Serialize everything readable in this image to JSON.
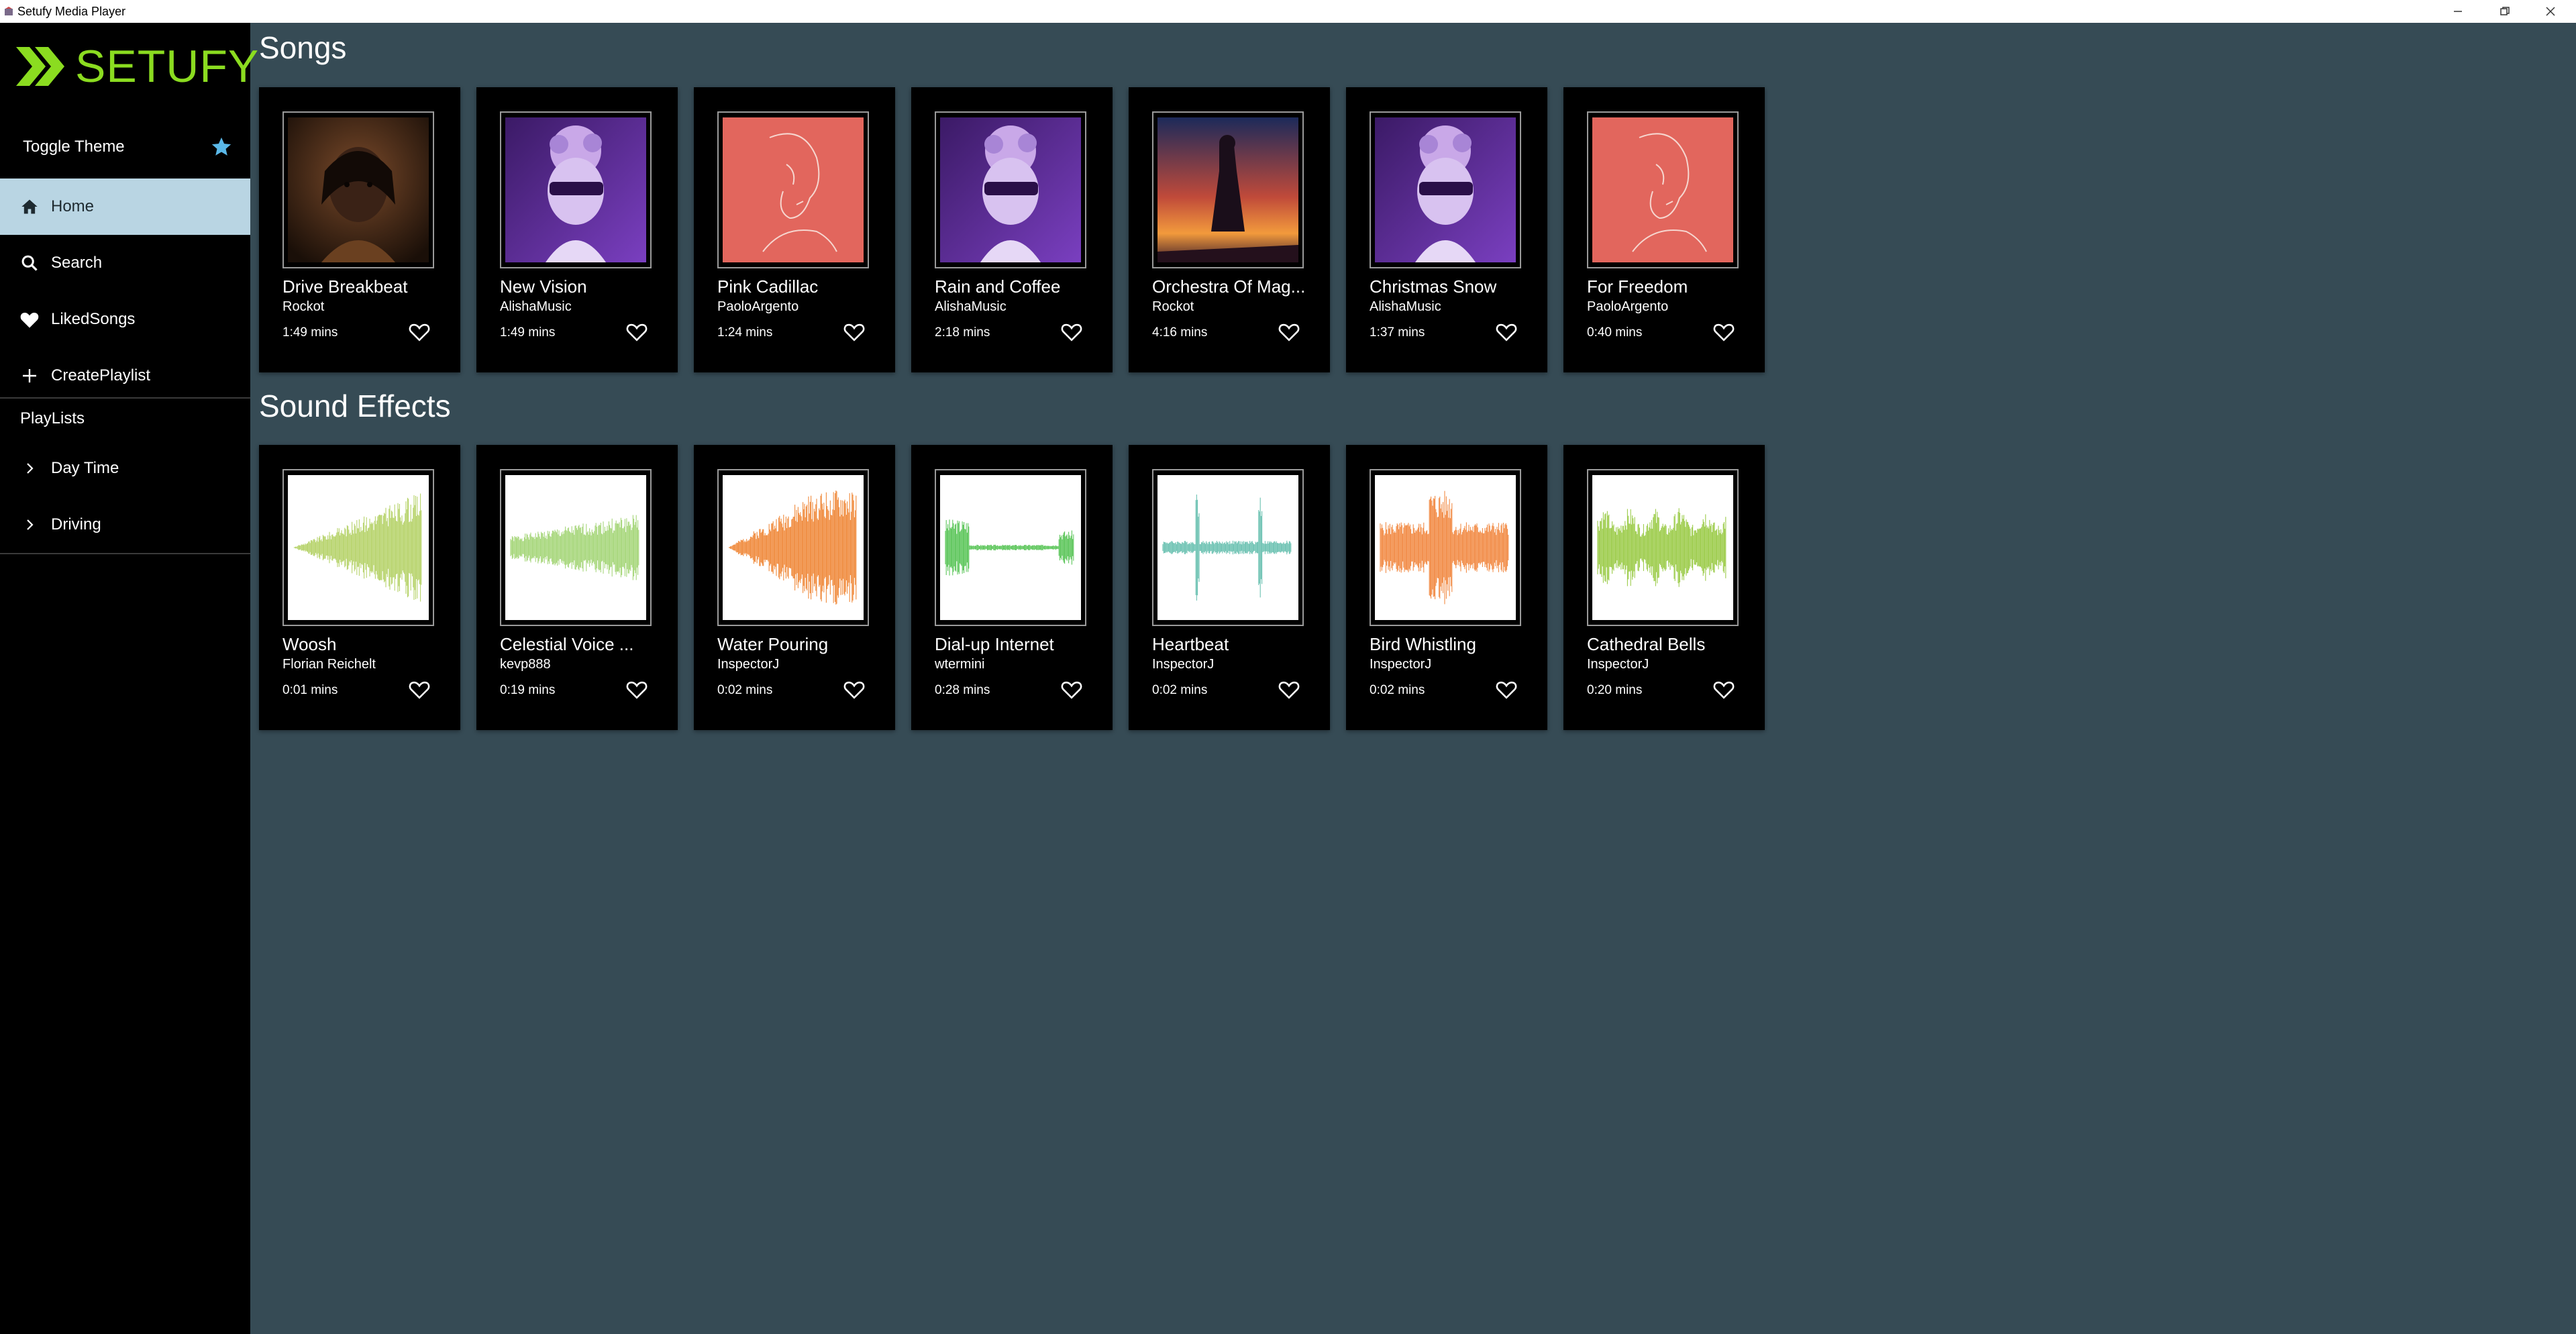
{
  "window": {
    "title": "Setufy Media Player"
  },
  "sidebar": {
    "logo": "SETUFY",
    "toggle_theme": "Toggle Theme",
    "nav": [
      {
        "label": "Home",
        "icon": "home-icon"
      },
      {
        "label": "Search",
        "icon": "search-icon"
      },
      {
        "label": "LikedSongs",
        "icon": "heart-icon"
      },
      {
        "label": "CreatePlaylist",
        "icon": "plus-icon"
      }
    ],
    "playlists_heading": "PlayLists",
    "playlists": [
      {
        "label": "Day Time"
      },
      {
        "label": "Driving"
      }
    ]
  },
  "sections": {
    "songs_title": "Songs",
    "effects_title": "Sound Effects"
  },
  "songs": [
    {
      "name": "Drive Breakbeat",
      "artist": "Rockot",
      "duration": "1:49 mins",
      "art": "portrait"
    },
    {
      "name": "New Vision",
      "artist": "AlishaMusic",
      "duration": "1:49 mins",
      "art": "statue"
    },
    {
      "name": "Pink Cadillac",
      "artist": "PaoloArgento",
      "duration": "1:24 mins",
      "art": "sketch"
    },
    {
      "name": "Rain and Coffee",
      "artist": "AlishaMusic",
      "duration": "2:18 mins",
      "art": "statue"
    },
    {
      "name": "Orchestra Of Mag...",
      "artist": "Rockot",
      "duration": "4:16 mins",
      "art": "sunset"
    },
    {
      "name": "Christmas Snow",
      "artist": "AlishaMusic",
      "duration": "1:37 mins",
      "art": "statue"
    },
    {
      "name": "For Freedom",
      "artist": "PaoloArgento",
      "duration": "0:40 mins",
      "art": "sketch"
    }
  ],
  "effects": [
    {
      "name": "Woosh",
      "artist": "Florian Reichelt",
      "duration": "0:01 mins",
      "wave_color": "#b6d36a"
    },
    {
      "name": "Celestial Voice ...",
      "artist": "kevp888",
      "duration": "0:19 mins",
      "wave_color": "#a6d67a"
    },
    {
      "name": "Water Pouring",
      "artist": "InspectorJ",
      "duration": "0:02 mins",
      "wave_color": "#f08a3c"
    },
    {
      "name": "Dial-up Internet",
      "artist": "wtermini",
      "duration": "0:28 mins",
      "wave_color": "#5cc65a"
    },
    {
      "name": "Heartbeat",
      "artist": "InspectorJ",
      "duration": "0:02 mins",
      "wave_color": "#6cc2b2"
    },
    {
      "name": "Bird Whistling",
      "artist": "InspectorJ",
      "duration": "0:02 mins",
      "wave_color": "#f28b45"
    },
    {
      "name": "Cathedral Bells",
      "artist": "InspectorJ",
      "duration": "0:20 mins",
      "wave_color": "#9ccc4a"
    }
  ],
  "colors": {
    "background": "#364b55",
    "sidebar": "#000000",
    "accent_green": "#8bdc20",
    "active_nav": "#b9d5e3",
    "star": "#5ab8e8"
  }
}
